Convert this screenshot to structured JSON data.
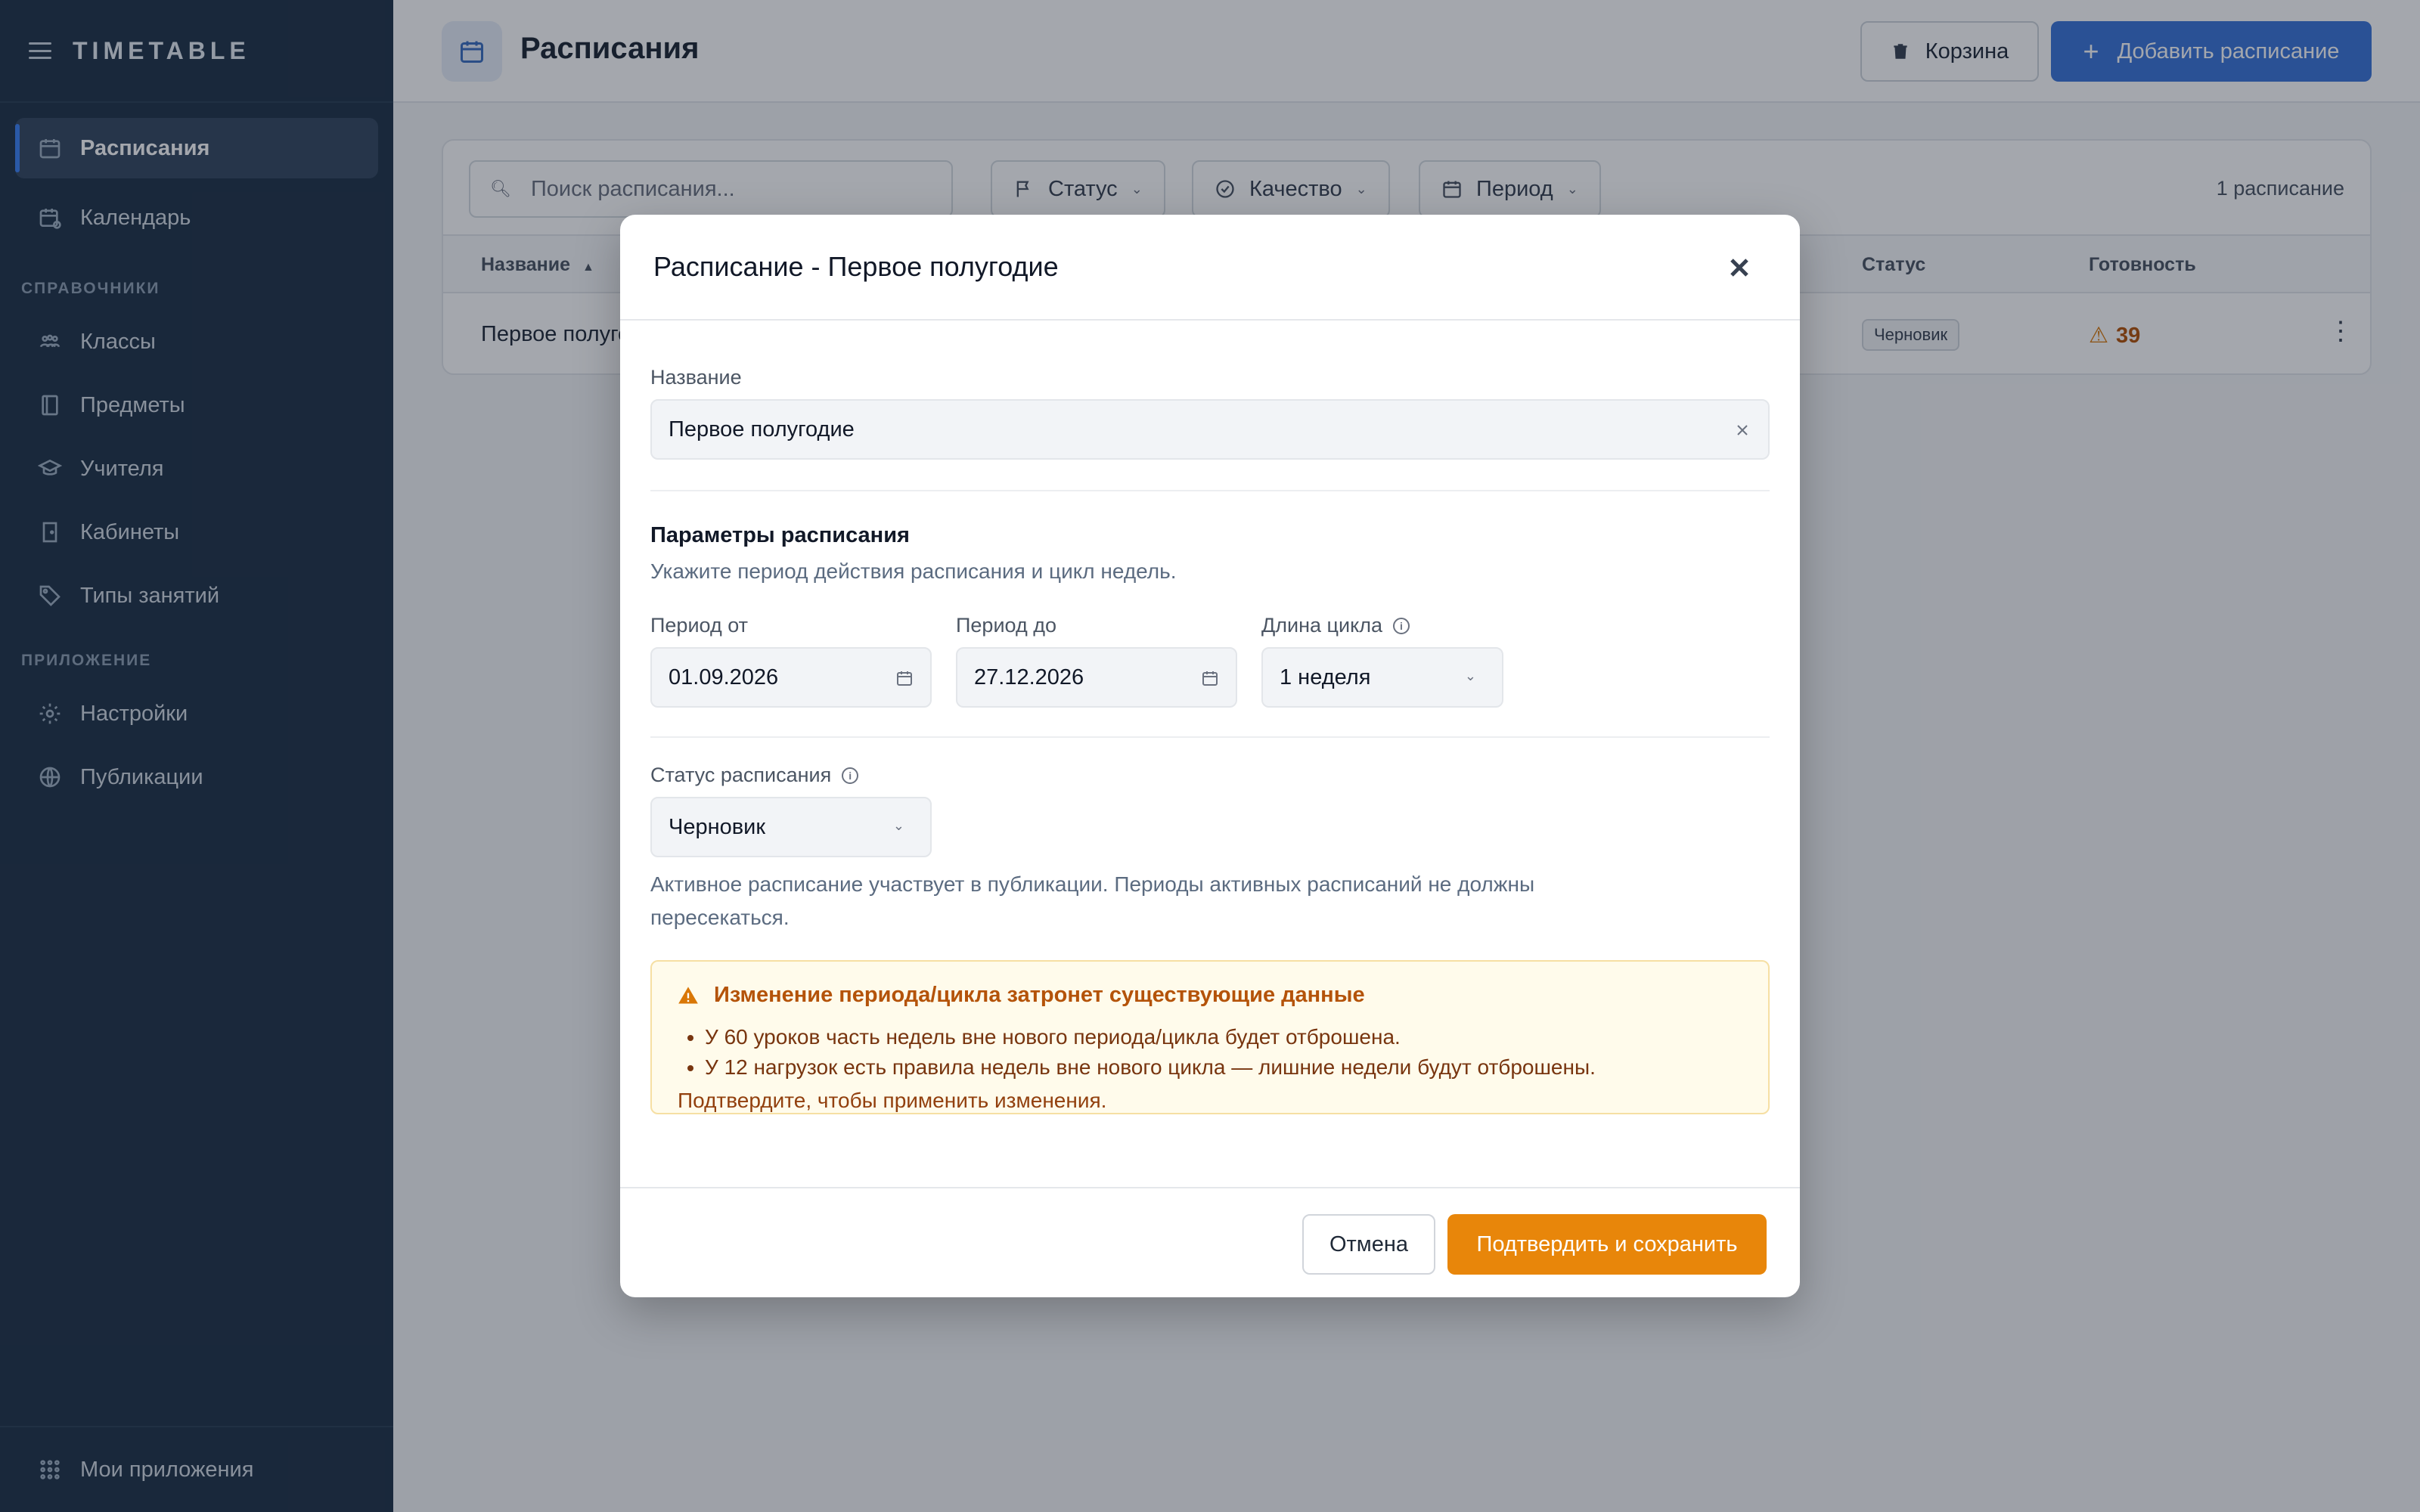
{
  "app": {
    "brand": "TIMETABLE"
  },
  "sidebar": {
    "items": [
      {
        "label": "Расписания",
        "icon": "calendar-icon"
      },
      {
        "label": "Календарь",
        "icon": "calendar-clock-icon"
      },
      {
        "label": "Классы",
        "icon": "users-icon"
      },
      {
        "label": "Предметы",
        "icon": "book-icon"
      },
      {
        "label": "Учителя",
        "icon": "graduation-cap-icon"
      },
      {
        "label": "Кабинеты",
        "icon": "door-icon"
      },
      {
        "label": "Типы занятий",
        "icon": "tag-icon"
      },
      {
        "label": "Настройки",
        "icon": "gear-icon"
      },
      {
        "label": "Публикации",
        "icon": "globe-icon"
      }
    ],
    "sections": {
      "references": "СПРАВОЧНИКИ",
      "application": "ПРИЛОЖЕНИЕ"
    },
    "footer": "Мои приложения"
  },
  "header": {
    "title": "Расписания",
    "trash_label": "Корзина",
    "add_label": "Добавить расписание"
  },
  "list": {
    "search_placeholder": "Поиск расписания...",
    "filters": {
      "status": "Статус",
      "quality": "Качество",
      "period": "Период"
    },
    "count": "1 расписание",
    "columns": {
      "name": "Название",
      "status": "Статус",
      "readiness": "Готовность"
    },
    "rows": [
      {
        "name": "Первое полугодие",
        "status": "Черновик",
        "readiness": "39"
      }
    ]
  },
  "modal": {
    "title": "Расписание - Первое полугодие",
    "name_label": "Название",
    "name_value": "Первое полугодие",
    "params_title": "Параметры расписания",
    "params_subtitle": "Укажите период действия расписания и цикл недель.",
    "period_from_label": "Период от",
    "period_from_value": "01.09.2026",
    "period_to_label": "Период до",
    "period_to_value": "27.12.2026",
    "cycle_label": "Длина цикла",
    "cycle_value": "1 неделя",
    "status_label": "Статус расписания",
    "status_value": "Черновик",
    "status_hint": "Активное расписание участвует в публикации. Периоды активных расписаний не должны пересекаться.",
    "alert": {
      "title": "Изменение периода/цикла затронет существующие данные",
      "items": [
        "У 60 уроков часть недель вне нового периода/цикла будет отброшена.",
        "У 12 нагрузок есть правила недель вне нового цикла — лишние недели будут отброшены."
      ],
      "footer": "Подтвердите, чтобы применить изменения."
    },
    "cancel_label": "Отмена",
    "confirm_label": "Подтвердить и сохранить"
  },
  "colors": {
    "sidebar_bg": "#1f3247",
    "primary": "#3b74d8",
    "confirm": "#e8860a",
    "warning_text": "#b45309",
    "warning_bg": "#fffbeb"
  }
}
